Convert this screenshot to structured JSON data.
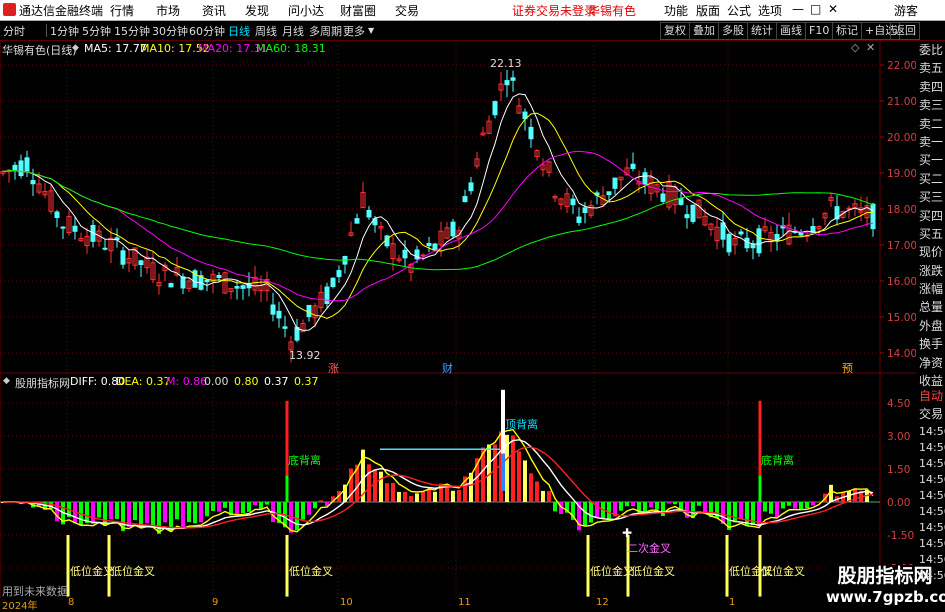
{
  "app": {
    "title": "通达信金融终端",
    "menus": [
      "行情",
      "市场",
      "资讯",
      "发现",
      "问小达",
      "财富圈",
      "交易"
    ],
    "login_notice": "证券交易未登录",
    "stock_name_top": "华锡有色",
    "right_menus": [
      "功能",
      "版面",
      "公式",
      "选项"
    ],
    "guest": "游客",
    "window_controls": [
      "—",
      "□",
      "✕"
    ]
  },
  "toolbar": {
    "periods": [
      "分时",
      "1分钟",
      "5分钟",
      "15分钟",
      "30分钟",
      "60分钟",
      "日线",
      "周线",
      "月线",
      "多周期",
      "更多"
    ],
    "active_period": "日线",
    "right_buttons": [
      "复权",
      "叠加",
      "多股",
      "统计",
      "画线",
      "F10",
      "标记",
      "+自选",
      "返回"
    ]
  },
  "main_chart": {
    "title": "华锡有色(日线)",
    "ma_items": [
      {
        "label": "MA5: 17.77",
        "color": "#ffffff"
      },
      {
        "label": "MA10: 17.52",
        "color": "#ffff00"
      },
      {
        "label": "MA20: 17.31",
        "color": "#ff00ff"
      },
      {
        "label": "MA60: 18.31",
        "color": "#00ff00"
      }
    ],
    "high_label": "22.13",
    "low_label": "13.92",
    "marks": [
      "涨",
      "财",
      "预"
    ],
    "y_ticks": [
      "22.00",
      "21.00",
      "20.00",
      "19.00",
      "18.00",
      "17.00",
      "16.00",
      "15.00",
      "14.00"
    ]
  },
  "indicator": {
    "title": "股朋指标网",
    "legend": [
      {
        "label": "DIFF: 0.80",
        "color": "#ffffff"
      },
      {
        "label": "DEA: 0.37",
        "color": "#ffff00"
      },
      {
        "label": "M: 0.86",
        "color": "#ff00ff"
      },
      {
        "label": "0.00",
        "color": "#dddddd"
      },
      {
        "label": "0.80",
        "color": "#ffff00"
      },
      {
        "label": "0.37",
        "color": "#ffffff"
      },
      {
        "label": "0.37",
        "color": "#ffff00"
      }
    ],
    "y_ticks": [
      "4.50",
      "3.00",
      "1.50",
      "0.00",
      "-1.50",
      "-3.00"
    ],
    "labels": {
      "top_div": "顶背离",
      "bottom_div": "底背离",
      "low_golden": "低位金叉",
      "second_golden": "二次金叉"
    }
  },
  "right_panel": {
    "items": [
      "委比",
      "卖五",
      "卖四",
      "卖三",
      "卖二",
      "卖一",
      "买一",
      "买二",
      "买三",
      "买四",
      "买五",
      "现价",
      "涨跌",
      "涨幅",
      "总量",
      "外盘",
      "换手",
      "净资",
      "收益"
    ],
    "auto_label": "自动",
    "trade_label": "交易",
    "times": [
      "14:56",
      "14:56",
      "14:56",
      "14:56",
      "14:56",
      "14:56",
      "14:56",
      "14:56",
      "14:56",
      "14:56"
    ]
  },
  "time_axis": {
    "labels": [
      "2024年",
      "8",
      "9",
      "10",
      "11",
      "12",
      "1"
    ]
  },
  "watermark": {
    "site_name": "股朋指标网",
    "site_url": "www.7gpzb.com",
    "footer_left": "用到未来数据"
  },
  "colors": {
    "up": "#ff3232",
    "down": "#54ffff",
    "ma5": "#ffffff",
    "ma10": "#ffff00",
    "ma20": "#ff00ff",
    "ma60": "#00ff00",
    "bg": "#000000",
    "grid": "#6a0000"
  }
}
